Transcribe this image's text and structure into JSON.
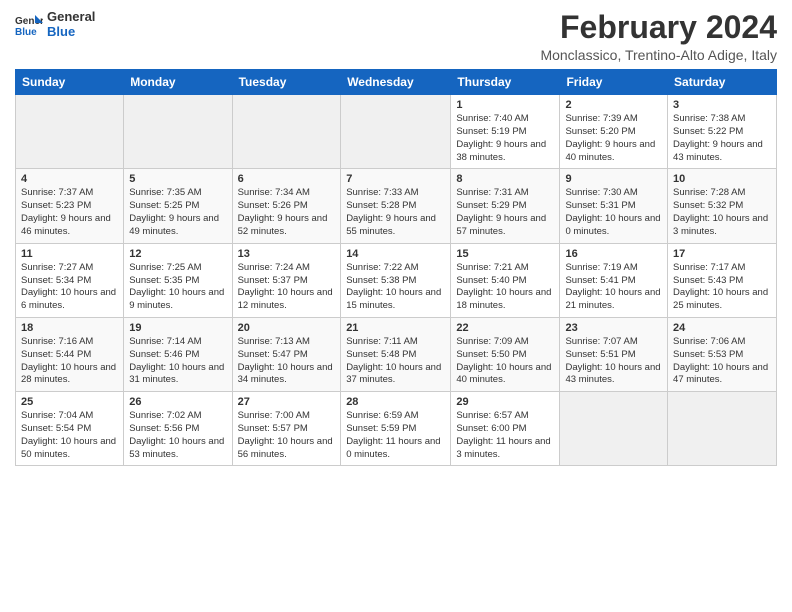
{
  "logo": {
    "line1": "General",
    "line2": "Blue"
  },
  "title": "February 2024",
  "subtitle": "Monclassico, Trentino-Alto Adige, Italy",
  "headers": [
    "Sunday",
    "Monday",
    "Tuesday",
    "Wednesday",
    "Thursday",
    "Friday",
    "Saturday"
  ],
  "weeks": [
    [
      {
        "day": "",
        "info": ""
      },
      {
        "day": "",
        "info": ""
      },
      {
        "day": "",
        "info": ""
      },
      {
        "day": "",
        "info": ""
      },
      {
        "day": "1",
        "info": "Sunrise: 7:40 AM\nSunset: 5:19 PM\nDaylight: 9 hours and 38 minutes."
      },
      {
        "day": "2",
        "info": "Sunrise: 7:39 AM\nSunset: 5:20 PM\nDaylight: 9 hours and 40 minutes."
      },
      {
        "day": "3",
        "info": "Sunrise: 7:38 AM\nSunset: 5:22 PM\nDaylight: 9 hours and 43 minutes."
      }
    ],
    [
      {
        "day": "4",
        "info": "Sunrise: 7:37 AM\nSunset: 5:23 PM\nDaylight: 9 hours and 46 minutes."
      },
      {
        "day": "5",
        "info": "Sunrise: 7:35 AM\nSunset: 5:25 PM\nDaylight: 9 hours and 49 minutes."
      },
      {
        "day": "6",
        "info": "Sunrise: 7:34 AM\nSunset: 5:26 PM\nDaylight: 9 hours and 52 minutes."
      },
      {
        "day": "7",
        "info": "Sunrise: 7:33 AM\nSunset: 5:28 PM\nDaylight: 9 hours and 55 minutes."
      },
      {
        "day": "8",
        "info": "Sunrise: 7:31 AM\nSunset: 5:29 PM\nDaylight: 9 hours and 57 minutes."
      },
      {
        "day": "9",
        "info": "Sunrise: 7:30 AM\nSunset: 5:31 PM\nDaylight: 10 hours and 0 minutes."
      },
      {
        "day": "10",
        "info": "Sunrise: 7:28 AM\nSunset: 5:32 PM\nDaylight: 10 hours and 3 minutes."
      }
    ],
    [
      {
        "day": "11",
        "info": "Sunrise: 7:27 AM\nSunset: 5:34 PM\nDaylight: 10 hours and 6 minutes."
      },
      {
        "day": "12",
        "info": "Sunrise: 7:25 AM\nSunset: 5:35 PM\nDaylight: 10 hours and 9 minutes."
      },
      {
        "day": "13",
        "info": "Sunrise: 7:24 AM\nSunset: 5:37 PM\nDaylight: 10 hours and 12 minutes."
      },
      {
        "day": "14",
        "info": "Sunrise: 7:22 AM\nSunset: 5:38 PM\nDaylight: 10 hours and 15 minutes."
      },
      {
        "day": "15",
        "info": "Sunrise: 7:21 AM\nSunset: 5:40 PM\nDaylight: 10 hours and 18 minutes."
      },
      {
        "day": "16",
        "info": "Sunrise: 7:19 AM\nSunset: 5:41 PM\nDaylight: 10 hours and 21 minutes."
      },
      {
        "day": "17",
        "info": "Sunrise: 7:17 AM\nSunset: 5:43 PM\nDaylight: 10 hours and 25 minutes."
      }
    ],
    [
      {
        "day": "18",
        "info": "Sunrise: 7:16 AM\nSunset: 5:44 PM\nDaylight: 10 hours and 28 minutes."
      },
      {
        "day": "19",
        "info": "Sunrise: 7:14 AM\nSunset: 5:46 PM\nDaylight: 10 hours and 31 minutes."
      },
      {
        "day": "20",
        "info": "Sunrise: 7:13 AM\nSunset: 5:47 PM\nDaylight: 10 hours and 34 minutes."
      },
      {
        "day": "21",
        "info": "Sunrise: 7:11 AM\nSunset: 5:48 PM\nDaylight: 10 hours and 37 minutes."
      },
      {
        "day": "22",
        "info": "Sunrise: 7:09 AM\nSunset: 5:50 PM\nDaylight: 10 hours and 40 minutes."
      },
      {
        "day": "23",
        "info": "Sunrise: 7:07 AM\nSunset: 5:51 PM\nDaylight: 10 hours and 43 minutes."
      },
      {
        "day": "24",
        "info": "Sunrise: 7:06 AM\nSunset: 5:53 PM\nDaylight: 10 hours and 47 minutes."
      }
    ],
    [
      {
        "day": "25",
        "info": "Sunrise: 7:04 AM\nSunset: 5:54 PM\nDaylight: 10 hours and 50 minutes."
      },
      {
        "day": "26",
        "info": "Sunrise: 7:02 AM\nSunset: 5:56 PM\nDaylight: 10 hours and 53 minutes."
      },
      {
        "day": "27",
        "info": "Sunrise: 7:00 AM\nSunset: 5:57 PM\nDaylight: 10 hours and 56 minutes."
      },
      {
        "day": "28",
        "info": "Sunrise: 6:59 AM\nSunset: 5:59 PM\nDaylight: 11 hours and 0 minutes."
      },
      {
        "day": "29",
        "info": "Sunrise: 6:57 AM\nSunset: 6:00 PM\nDaylight: 11 hours and 3 minutes."
      },
      {
        "day": "",
        "info": ""
      },
      {
        "day": "",
        "info": ""
      }
    ]
  ]
}
